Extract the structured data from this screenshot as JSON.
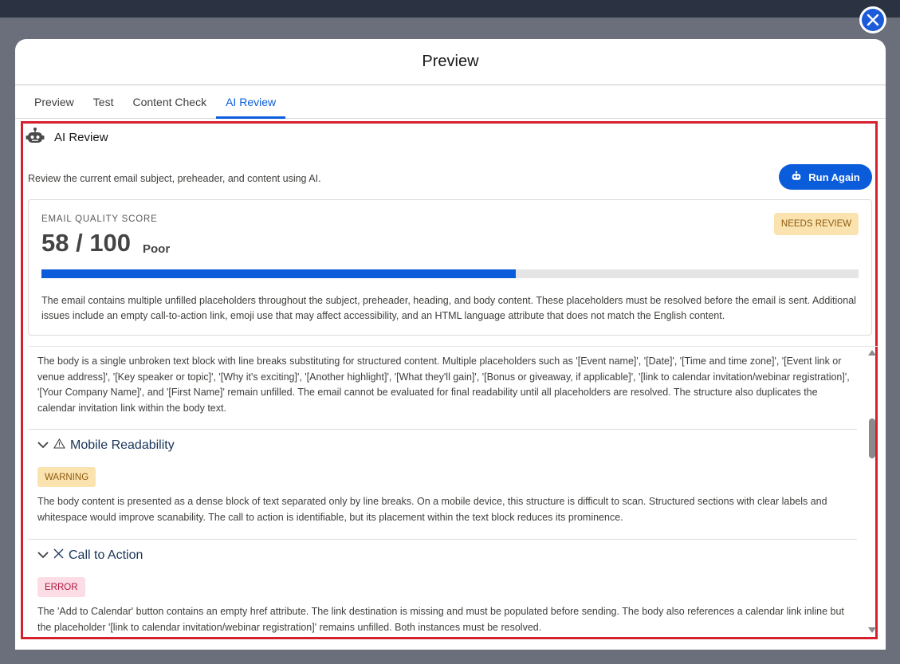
{
  "modal": {
    "title": "Preview"
  },
  "tabs": [
    {
      "label": "Preview",
      "active": false
    },
    {
      "label": "Test",
      "active": false
    },
    {
      "label": "Content Check",
      "active": false
    },
    {
      "label": "AI Review",
      "active": true
    }
  ],
  "review": {
    "title": "AI Review",
    "icon": "robot-icon",
    "description": "Review the current email subject, preheader, and content using AI.",
    "run_again_label": "Run Again"
  },
  "score": {
    "label": "EMAIL QUALITY SCORE",
    "value": "58 / 100",
    "grade": "Poor",
    "badge": "NEEDS REVIEW",
    "progress_percent": 58,
    "summary": "The email contains multiple unfilled placeholders throughout the subject, preheader, heading, and body content. These placeholders must be resolved before the email is sent. Additional issues include an empty call-to-action link, emoji use that may affect accessibility, and an HTML language attribute that does not match the English content."
  },
  "sections": {
    "body_paragraph": "The body is a single unbroken text block with line breaks substituting for structured content. Multiple placeholders such as '[Event name]', '[Date]', '[Time and time zone]', '[Event link or venue address]', '[Key speaker or topic]', '[Why it's exciting]', '[Another highlight]', '[What they'll gain]', '[Bonus or giveaway, if applicable]', '[link to calendar invitation/webinar registration]', '[Your Company Name]', and '[First Name]' remain unfilled. The email cannot be evaluated for final readability until all placeholders are resolved. The structure also duplicates the calendar invitation link within the body text.",
    "mobile": {
      "title": "Mobile Readability",
      "status_icon": "warning-icon",
      "badge": "WARNING",
      "text": "The body content is presented as a dense block of text separated only by line breaks. On a mobile device, this structure is difficult to scan. Structured sections with clear labels and whitespace would improve scanability. The call to action is identifiable, but its placement within the text block reduces its prominence."
    },
    "cta": {
      "title": "Call to Action",
      "status_icon": "x-icon",
      "badge": "ERROR",
      "text": "The 'Add to Calendar' button contains an empty href attribute. The link destination is missing and must be populated before sending. The body also references a calendar link inline but the placeholder '[link to calendar invitation/webinar registration]' remains unfilled. Both instances must be resolved."
    }
  },
  "colors": {
    "accent": "#0b5cdb",
    "frame_highlight": "#d5202e",
    "warning_bg": "#fbe3b0",
    "error_bg": "#fcdde5"
  }
}
